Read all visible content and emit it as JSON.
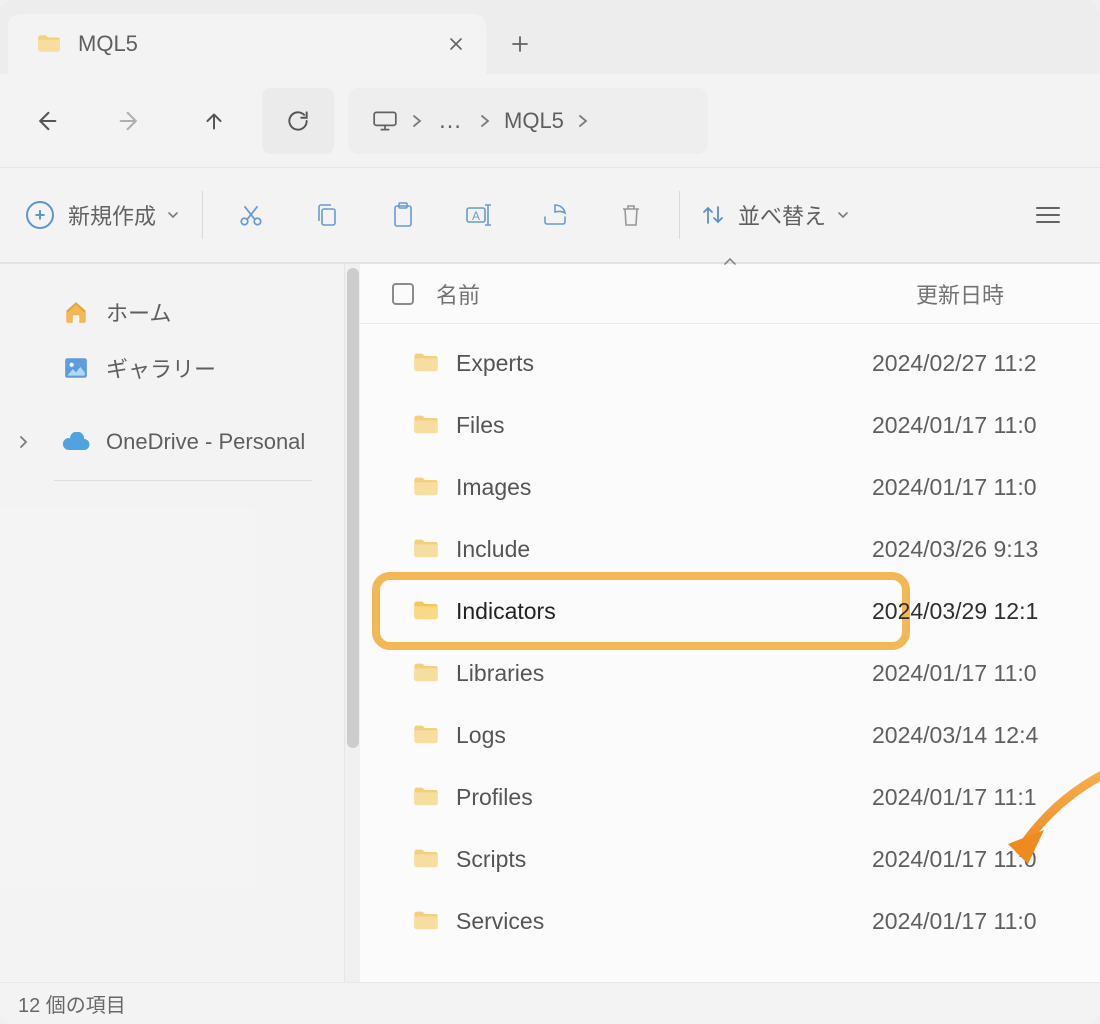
{
  "tab": {
    "title": "MQL5"
  },
  "breadcrumb": {
    "current": "MQL5"
  },
  "toolbar": {
    "new_label": "新規作成",
    "sort_label": "並べ替え"
  },
  "sidebar": {
    "home": "ホーム",
    "gallery": "ギャラリー",
    "onedrive": "OneDrive - Personal"
  },
  "columns": {
    "name": "名前",
    "date": "更新日時"
  },
  "rows": [
    {
      "name": "Experts",
      "date": "2024/02/27 11:2"
    },
    {
      "name": "Files",
      "date": "2024/01/17 11:0"
    },
    {
      "name": "Images",
      "date": "2024/01/17 11:0"
    },
    {
      "name": "Include",
      "date": "2024/03/26 9:13"
    },
    {
      "name": "Indicators",
      "date": "2024/03/29 12:1"
    },
    {
      "name": "Libraries",
      "date": "2024/01/17 11:0"
    },
    {
      "name": "Logs",
      "date": "2024/03/14 12:4"
    },
    {
      "name": "Profiles",
      "date": "2024/01/17 11:1"
    },
    {
      "name": "Scripts",
      "date": "2024/01/17 11:0"
    },
    {
      "name": "Services",
      "date": "2024/01/17 11:0"
    }
  ],
  "highlight_index": 4,
  "status": "12 個の項目"
}
